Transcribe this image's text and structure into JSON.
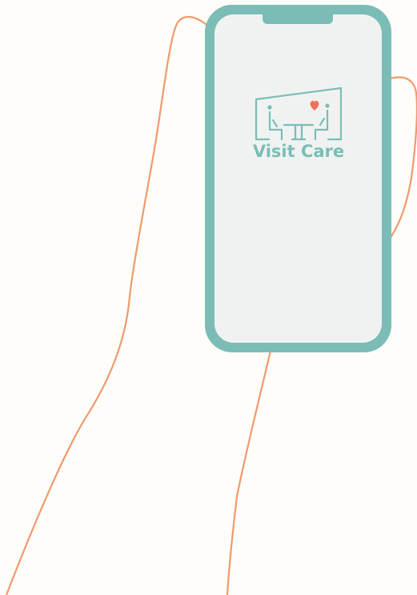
{
  "app": {
    "name": "Visit Care"
  },
  "colors": {
    "background": "#fefdf9",
    "hand_outline": "#ef9a6e",
    "phone_frame": "#7bbdb6",
    "phone_screen": "#f0f2f1",
    "brand": "#7bbdb6",
    "heart": "#ef6f5e"
  },
  "icons": {
    "logo": "visit-care-logo-icon",
    "heart": "heart-icon",
    "notch": "phone-notch"
  }
}
